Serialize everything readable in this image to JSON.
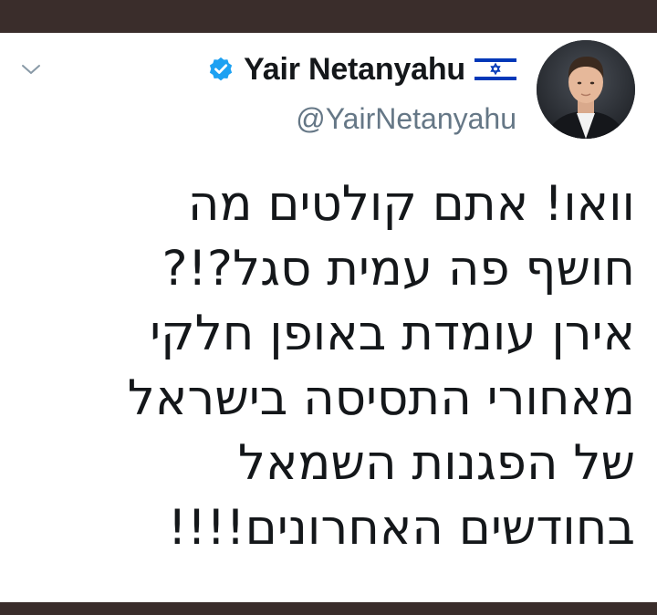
{
  "tweet": {
    "author": {
      "display_name": "Yair Netanyahu",
      "handle": "@YairNetanyahu",
      "verified": true,
      "flag_icon": "israel-flag-icon",
      "avatar_icon": "profile-avatar"
    },
    "lines": [
      "וואו! אתם קולטים מה",
      "חושף פה עמית סגל?!?",
      "אירן עומדת באופן חלקי",
      "מאחורי התסיסה בישראל",
      "של הפגנות השמאל",
      "בחודשים האחרונים!!!!"
    ]
  },
  "colors": {
    "frame_background": "#3a2d2b",
    "card_background": "#ffffff",
    "name_text": "#14171a",
    "handle_text": "#657786",
    "verified_badge": "#1da1f2",
    "flag_blue": "#0038b8"
  }
}
